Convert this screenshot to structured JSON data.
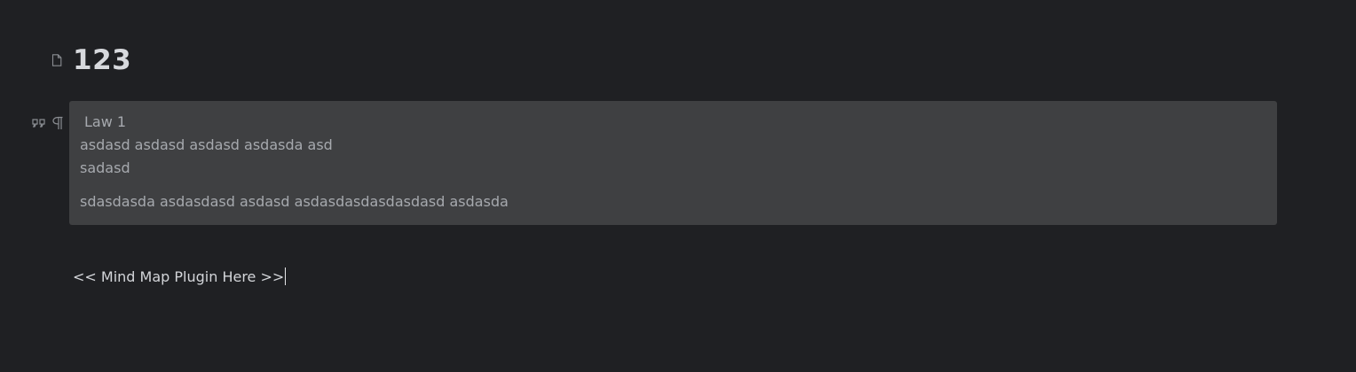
{
  "document": {
    "title": "123",
    "icon": "document-icon"
  },
  "block_handles": {
    "icons": [
      "quote-icon",
      "paragraph-icon"
    ]
  },
  "quote_block": {
    "title": "Law 1",
    "lines": [
      "asdasd asdasd asdasd asdasda asd",
      "sadasd",
      "sdasdasda asdasdasd asdasd asdasdasdasdasdasd asdasda"
    ]
  },
  "editor": {
    "placeholder_line": "<< Mind Map Plugin Here >>"
  },
  "colors": {
    "background": "#1f2023",
    "quote_background": "#3f4042",
    "muted_text": "#a6a9ae",
    "title_text": "#d7d9dd"
  }
}
